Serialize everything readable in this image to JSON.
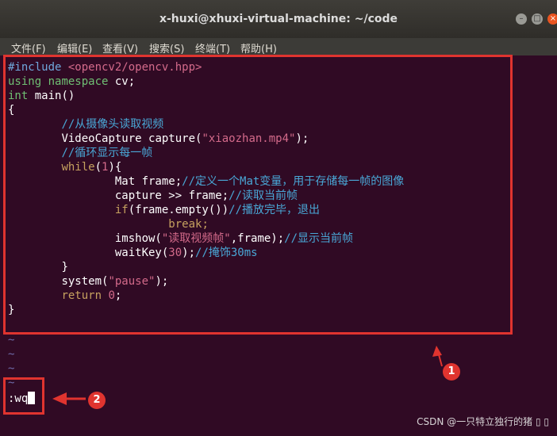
{
  "window": {
    "title": "x-huxi@xhuxi-virtual-machine: ~/code",
    "min": "–",
    "max": "□",
    "close": "×"
  },
  "menu": {
    "items": [
      "文件(F)",
      "编辑(E)",
      "查看(V)",
      "搜索(S)",
      "终端(T)",
      "帮助(H)"
    ]
  },
  "code": {
    "l1_a": "#include ",
    "l1_b": "<opencv2/opencv.hpp>",
    "l2_a": "using",
    "l2_b": " namespace",
    "l2_c": " cv;",
    "l3_a": "int",
    "l3_b": " main()",
    "l4": "{",
    "l5": "//从摄像头读取视频",
    "l6_a": "VideoCapture capture(",
    "l6_b": "\"xiaozhan.mp4\"",
    "l6_c": ");",
    "l7": "//循环显示每一帧",
    "l8_a": "while",
    "l8_b": "(",
    "l8_c": "1",
    "l8_d": "){",
    "l9_a": "Mat frame;",
    "l9_b": "//定义一个Mat变量，用于存储每一帧的图像",
    "l10_a": "capture >> frame;",
    "l10_b": "//读取当前帧",
    "l11_a": "if",
    "l11_b": "(frame.empty())",
    "l11_c": "//播放完毕，退出",
    "l12": "break;",
    "l13_a": "imshow(",
    "l13_b": "\"读取视频帧\"",
    "l13_c": ",frame);",
    "l13_d": "//显示当前帧",
    "l14_a": "waitKey(",
    "l14_b": "30",
    "l14_c": ");",
    "l14_d": "//掩饰30ms",
    "l15": "}",
    "l16_a": "system(",
    "l16_b": "\"pause\"",
    "l16_c": ");",
    "l17_a": "return",
    "l17_b": " 0",
    "l17_c": ";",
    "l18": "}",
    "tilde": "~"
  },
  "command": {
    "text": ":wq"
  },
  "annotations": {
    "badge1": "1",
    "badge2": "2",
    "arrow_color": "#e0342f"
  },
  "watermark": "CSDN @一只特立独行的猪 ▯ ▯"
}
